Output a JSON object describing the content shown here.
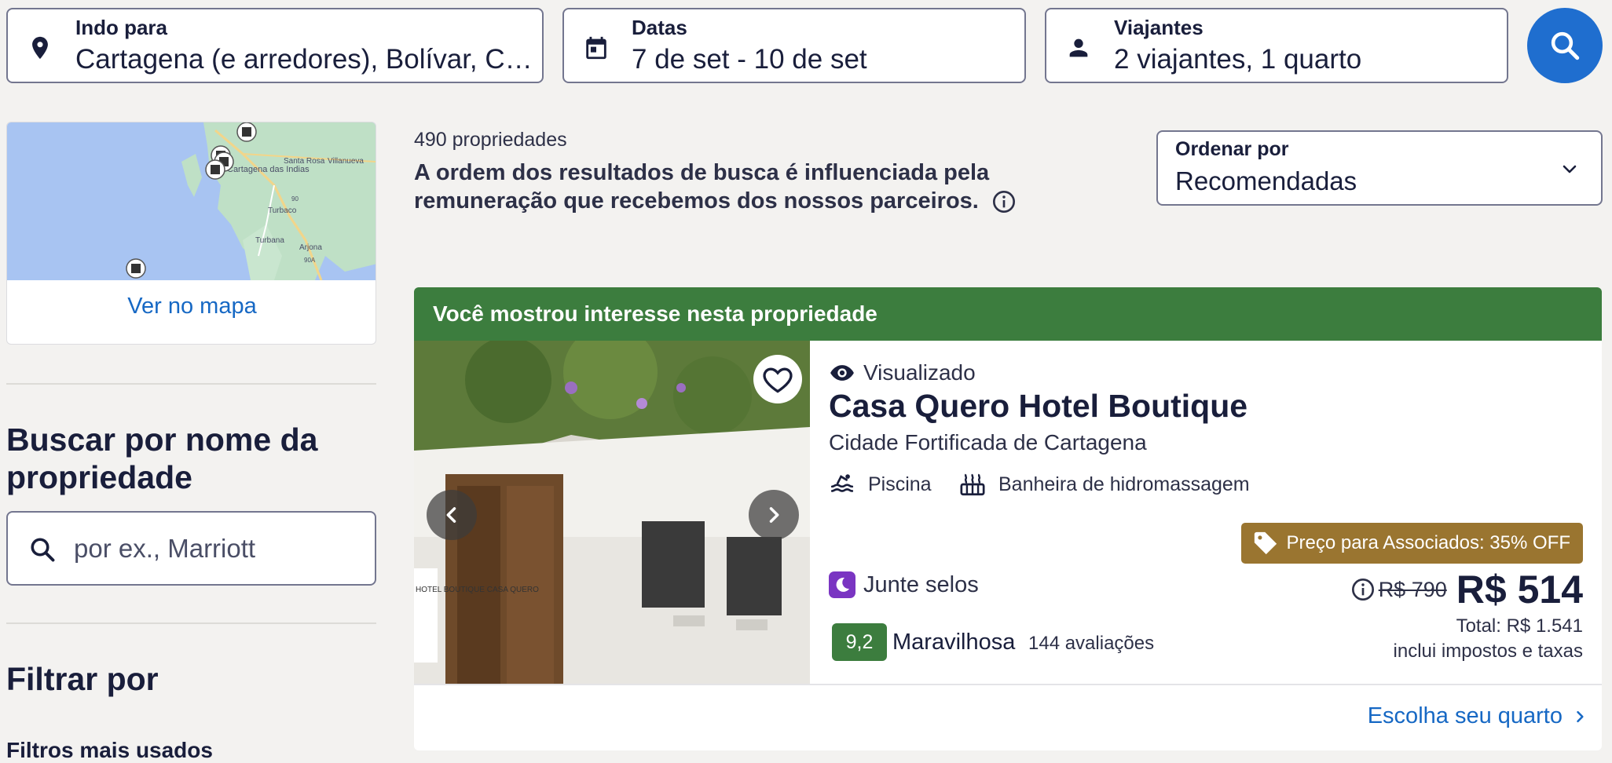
{
  "search": {
    "destination_label": "Indo para",
    "destination_value": "Cartagena (e arredores), Bolívar, Colômbia",
    "dates_label": "Datas",
    "dates_value": "7 de set - 10 de set",
    "travelers_label": "Viajantes",
    "travelers_value": "2 viajantes, 1 quarto",
    "search_button_icon": "search-icon"
  },
  "sidebar": {
    "map": {
      "link": "Ver no mapa",
      "place_labels": [
        "Cartagena das Indias",
        "Santa Rosa",
        "Villanueva",
        "Turbaco",
        "Turbana",
        "Arjona",
        "90",
        "90A"
      ]
    },
    "search_by_name": {
      "title": "Buscar por nome da propriedade",
      "placeholder": "por ex., Marriott"
    },
    "filter": {
      "title": "Filtrar por",
      "subtitle": "Filtros mais usados"
    }
  },
  "results": {
    "count": "490 propriedades",
    "disclaimer": "A ordem dos resultados de busca é influenciada pela remuneração que recebemos dos nossos parceiros.",
    "sort": {
      "label": "Ordenar por",
      "value": "Recomendadas"
    }
  },
  "property": {
    "banner": "Você mostrou interesse nesta propriedade",
    "viewed": "Visualizado",
    "name": "Casa Quero Hotel Boutique",
    "location": "Cidade Fortificada de Cartagena",
    "amenities": [
      {
        "label": "Piscina",
        "icon": "pool-icon"
      },
      {
        "label": "Banheira de hidromassagem",
        "icon": "hot-tub-icon"
      }
    ],
    "loyalty": "Junte selos",
    "rating": "9,2",
    "rating_word": "Maravilhosa",
    "reviews": "144 avaliações",
    "member_deal": "Preço para Associados: 35% OFF",
    "old_price": "R$ 790",
    "price": "R$ 514",
    "total": "Total: R$ 1.541",
    "taxes": "inclui impostos e taxas",
    "cta": "Escolha seu quarto",
    "photo_sign": "HOTEL BOUTIQUE CASA QUERO"
  },
  "colors": {
    "brand_blue": "#1f6ecf",
    "link_blue": "#1668c4",
    "banner_green": "#3c7d3e",
    "member_gold": "#9a7530",
    "loyalty_purple": "#7a35c2"
  }
}
